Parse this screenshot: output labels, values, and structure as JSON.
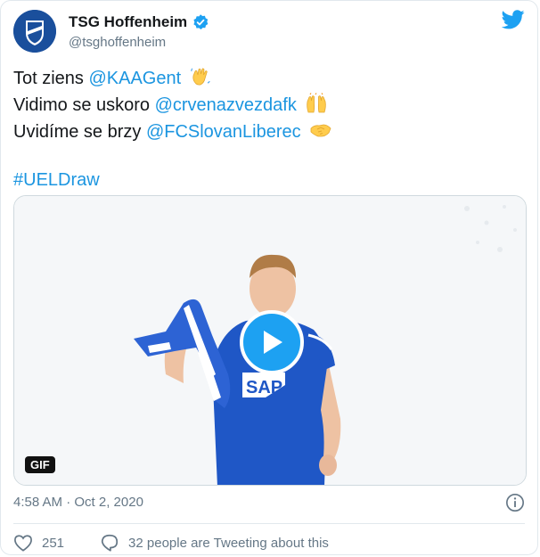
{
  "account": {
    "display_name": "TSG Hoffenheim",
    "handle": "@tsghoffenheim",
    "verified": true
  },
  "tweet": {
    "lines": [
      {
        "prefix": "Tot ziens ",
        "mention": "@KAAGent",
        "emoji": "waving-hand"
      },
      {
        "prefix": "Vidimo se uskoro ",
        "mention": "@crvenazvezdafk",
        "emoji": "raising-hands"
      },
      {
        "prefix": "Uvidíme se brzy ",
        "mention": "@FCSlovanLiberec",
        "emoji": "handshake"
      }
    ],
    "hashtag": "#UELDraw"
  },
  "media": {
    "badge": "GIF",
    "jersey_sponsor": "SAP"
  },
  "timestamp": "4:58 AM · Oct 2, 2020",
  "actions": {
    "likes": "251",
    "tweeting": "32 people are Tweeting about this"
  },
  "colors": {
    "link": "#1b95e0",
    "twitter_blue": "#1da1f2",
    "muted": "#657786",
    "club_blue": "#1a4f9c"
  },
  "icons": [
    "verified-icon",
    "twitter-bird-icon",
    "play-icon",
    "info-icon",
    "heart-icon",
    "speech-bubble-icon"
  ]
}
